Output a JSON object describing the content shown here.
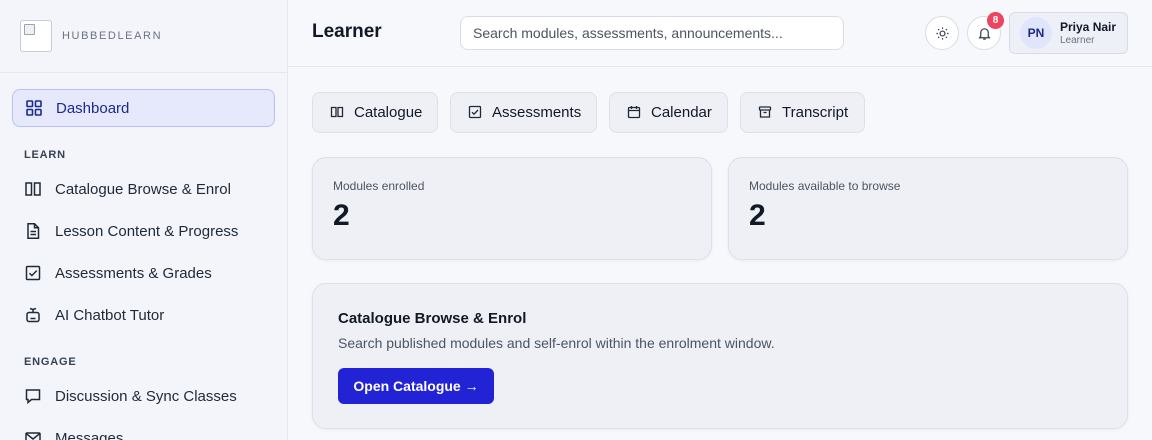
{
  "brand": {
    "name": "HUBBEDLEARN"
  },
  "sidebar": {
    "dashboard": {
      "label": "Dashboard",
      "icon": "grid-icon"
    },
    "sections": [
      {
        "label": "LEARN",
        "items": [
          {
            "label": "Catalogue Browse & Enrol",
            "icon": "book-open-icon"
          },
          {
            "label": "Lesson Content & Progress",
            "icon": "document-icon"
          },
          {
            "label": "Assessments & Grades",
            "icon": "checkbox-icon"
          },
          {
            "label": "AI Chatbot Tutor",
            "icon": "bot-icon"
          }
        ]
      },
      {
        "label": "ENGAGE",
        "items": [
          {
            "label": "Discussion & Sync Classes",
            "icon": "chat-bubble-icon"
          },
          {
            "label": "Messages",
            "icon": "mail-icon"
          }
        ]
      }
    ]
  },
  "header": {
    "title": "Learner",
    "search_placeholder": "Search modules, assessments, announcements...",
    "notification_count": "8",
    "user": {
      "initials": "PN",
      "name": "Priya Nair",
      "role": "Learner"
    }
  },
  "quick_actions": [
    {
      "label": "Catalogue",
      "icon": "book-open-icon"
    },
    {
      "label": "Assessments",
      "icon": "checkbox-icon"
    },
    {
      "label": "Calendar",
      "icon": "calendar-icon"
    },
    {
      "label": "Transcript",
      "icon": "archive-icon"
    }
  ],
  "stats": [
    {
      "label": "Modules enrolled",
      "value": "2"
    },
    {
      "label": "Modules available to browse",
      "value": "2"
    }
  ],
  "panel": {
    "title": "Catalogue Browse & Enrol",
    "description": "Search published modules and self-enrol within the enrolment window.",
    "button_label": "Open Catalogue →"
  },
  "colors": {
    "accent": "#2323d6",
    "badge": "#ef4461",
    "active_nav_bg": "#e6e9fb"
  }
}
